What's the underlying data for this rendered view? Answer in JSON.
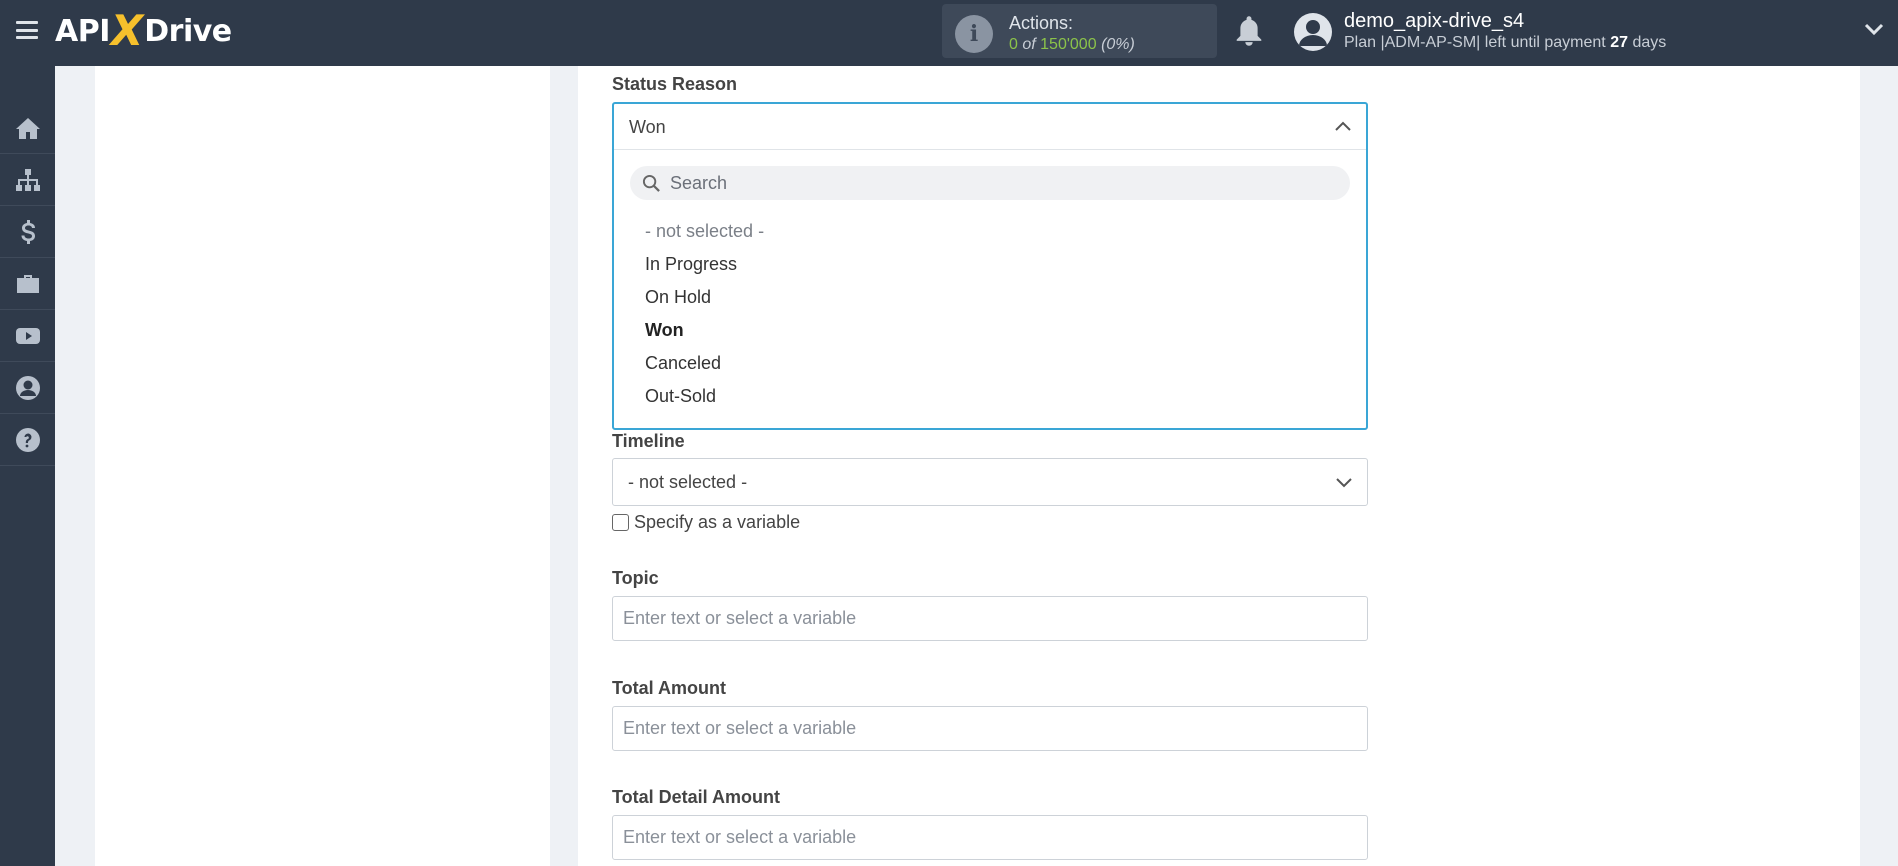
{
  "header": {
    "logo_left": "API",
    "logo_x": "X",
    "logo_right": "Drive",
    "actions_label": "Actions:",
    "actions_used": "0",
    "actions_of": "of",
    "actions_total": "150'000",
    "actions_percent": "(0%)",
    "user_name": "demo_apix-drive_s4",
    "plan_text": "Plan |ADM-AP-SM| left until payment",
    "days_value": "27",
    "days_unit": "days"
  },
  "sidebar": {
    "items": [
      {
        "icon": "home-icon"
      },
      {
        "icon": "sitemap-icon"
      },
      {
        "icon": "dollar-icon"
      },
      {
        "icon": "briefcase-icon"
      },
      {
        "icon": "youtube-icon"
      },
      {
        "icon": "user-circle-icon"
      },
      {
        "icon": "question-icon"
      }
    ]
  },
  "form": {
    "status_reason": {
      "label": "Status Reason",
      "value": "Won",
      "search_placeholder": "Search",
      "options": [
        "- not selected -",
        "In Progress",
        "On Hold",
        "Won",
        "Canceled",
        "Out-Sold"
      ]
    },
    "timeline": {
      "label": "Timeline",
      "value": "- not selected -",
      "variable_label": "Specify as a variable"
    },
    "topic": {
      "label": "Topic",
      "placeholder": "Enter text or select a variable"
    },
    "total_amount": {
      "label": "Total Amount",
      "placeholder": "Enter text or select a variable"
    },
    "total_detail_amount": {
      "label": "Total Detail Amount",
      "placeholder": "Enter text or select a variable"
    }
  },
  "colors": {
    "topbar": "#2f3a4a",
    "accent_focus": "#3aa6d6",
    "logo_x": "#f6c02c",
    "actions_green": "#8bc34a"
  }
}
